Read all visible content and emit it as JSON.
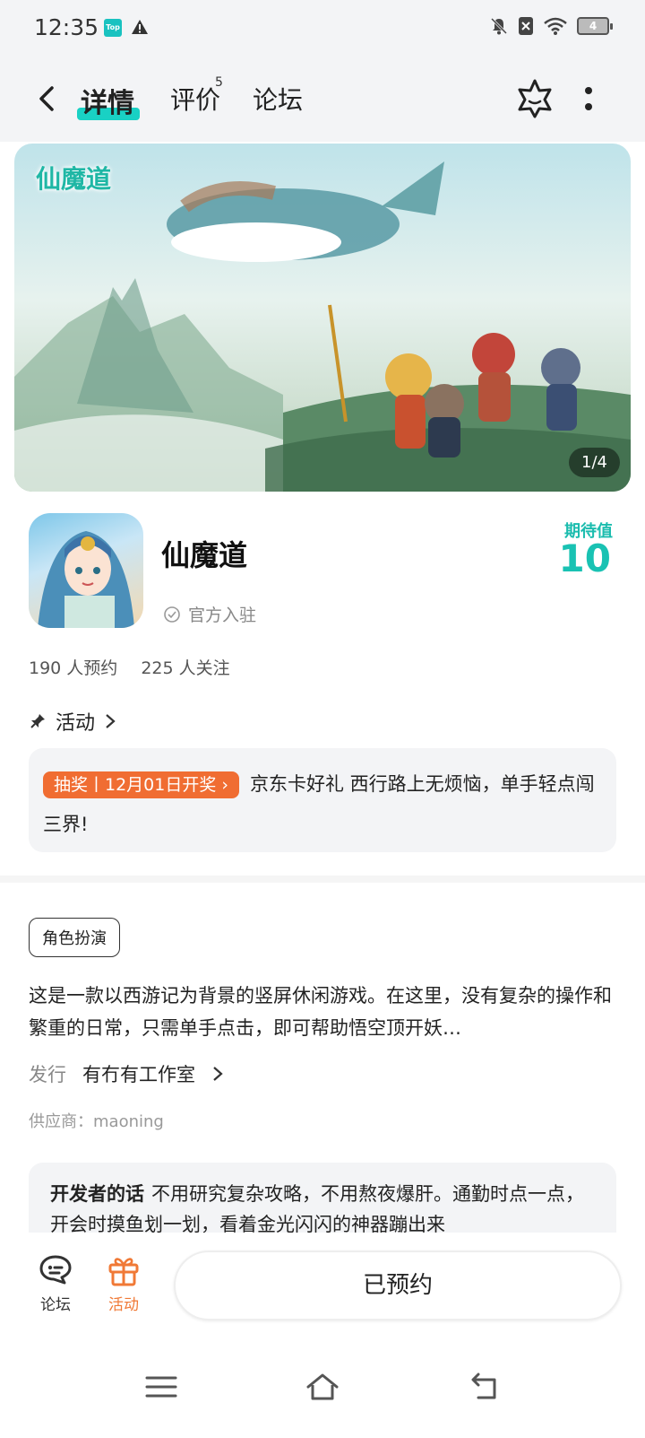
{
  "status_bar": {
    "time": "12:35",
    "app_badge": "Top",
    "battery": "4"
  },
  "header": {
    "tabs": [
      {
        "label": "详情",
        "active": true
      },
      {
        "label": "评价",
        "badge": "5"
      },
      {
        "label": "论坛"
      }
    ]
  },
  "banner": {
    "logo_text": "仙魔道",
    "counter": "1/4"
  },
  "game": {
    "title": "仙魔道",
    "official_label": "官方入驻",
    "expect_label": "期待值",
    "expect_value": "10",
    "reservations": "190 人预约",
    "followers": "225 人关注"
  },
  "activity": {
    "section_label": "活动",
    "tag": "抽奖丨12月01日开奖 ›",
    "text": "京东卡好礼 西行路上无烦恼，单手轻点闯三界!"
  },
  "details": {
    "genre": "角色扮演",
    "description": "这是一款以西游记为背景的竖屏休闲游戏。在这里，没有复杂的操作和繁重的日常，只需单手点击，即可帮助悟空顶开妖…",
    "publisher_label": "发行",
    "publisher_name": "有冇有工作室",
    "supplier": "供应商：maoning",
    "dev_title": "开发者的话",
    "dev_text": "不用研究复杂攻略，不用熬夜爆肝。通勤时点一点，开会时摸鱼划一划，看着金光闪闪的神器蹦出来"
  },
  "action_bar": {
    "forum_label": "论坛",
    "activity_label": "活动",
    "reserve_label": "已预约"
  },
  "colors": {
    "accent": "#19d1c4",
    "orange": "#f06d32"
  }
}
